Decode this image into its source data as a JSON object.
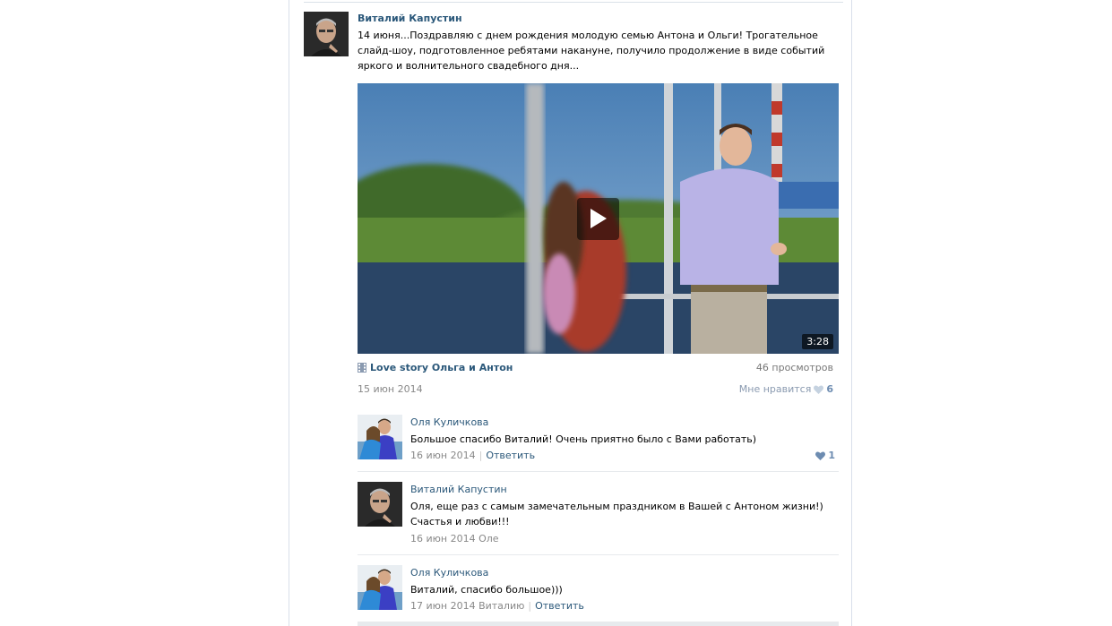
{
  "post": {
    "author": "Виталий Капустин",
    "text": "14 июня...Поздравляю с днем рождения молодую семью Антона и Ольги! Трогательное слайд-шоу, подготовленное ребятами накануне, получило продолжение в виде событий яркого и волнительного свадебного дня...",
    "video": {
      "title": "Love story Ольга и Антон",
      "duration": "3:28",
      "views": "46 просмотров"
    },
    "date": "15 июн 2014",
    "like_label": "Мне нравится",
    "like_count": "6"
  },
  "comments": [
    {
      "author": "Оля Куличкова",
      "text": "Большое спасибо Виталий! Очень приятно было с Вами работать)",
      "date": "16 июн 2014",
      "reply": "Ответить",
      "likes": "1"
    },
    {
      "author": "Виталий Капустин",
      "text": "Оля, еще раз с самым замечательным праздником в Вашей с Антоном жизни!) Счастья и любви!!!",
      "date": "16 июн 2014 Оле"
    },
    {
      "author": "Оля Куличкова",
      "text": "Виталий, спасибо большое)))",
      "date": "17 июн 2014 Виталию",
      "reply": "Ответить"
    }
  ],
  "colors": {
    "link": "#2b587a",
    "muted": "#888888",
    "like": "#6d8cb1"
  },
  "icons": {
    "play": "play-icon",
    "film": "film-icon",
    "heart": "heart-icon"
  }
}
